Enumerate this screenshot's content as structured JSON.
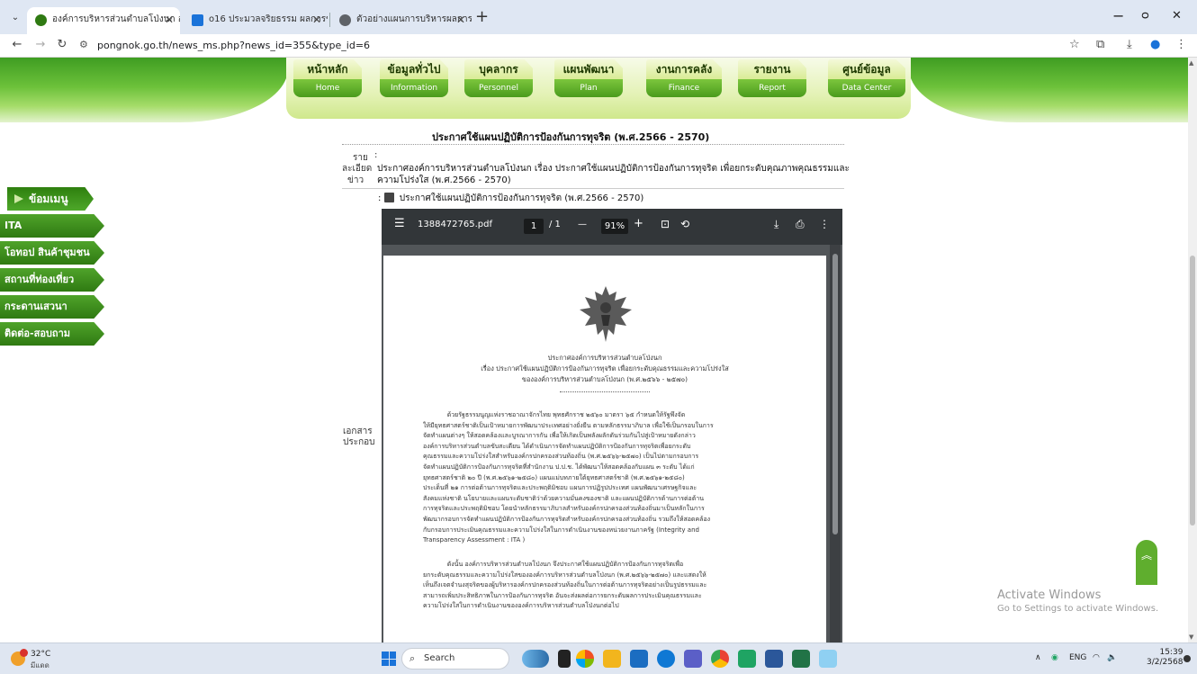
{
  "browser": {
    "tabs": [
      {
        "label": "องค์การบริหารส่วนตำบลโป่งนก อำเภ",
        "favicon_color": "#2f7a12"
      },
      {
        "label": "o16 ประมวลจริยธรรม ผลการขับเคล",
        "favicon_color": "#1a73d9"
      },
      {
        "label": "ตัวอย่างแผนการบริหารผลการพัฒน",
        "favicon_color": "#5f6368"
      }
    ],
    "url": "pongnok.go.th/news_ms.php?news_id=355&type_id=6",
    "window_controls": {
      "minimize": "−",
      "restore": "ᴑ",
      "close": "✕"
    }
  },
  "menu": [
    {
      "th": "หน้าหลัก",
      "en": "Home"
    },
    {
      "th": "ข้อมูลทั่วไป",
      "en": "Information"
    },
    {
      "th": "บุคลากร",
      "en": "Personnel"
    },
    {
      "th": "แผนพัฒนา",
      "en": "Plan"
    },
    {
      "th": "งานการคลัง",
      "en": "Finance"
    },
    {
      "th": "รายงาน",
      "en": "Report"
    },
    {
      "th": "ศูนย์ข้อมูล",
      "en": "Data Center"
    }
  ],
  "sidebar": {
    "header": "ข้อมเมนู",
    "items": [
      "ITA",
      "โอทอป สินค้าชุมชน",
      "สถานที่ท่องเที่ยว",
      "กระดานเสวนา",
      "ติดต่อ-สอบถาม"
    ]
  },
  "news": {
    "title": "ประกาศใช้แผนปฏิบัติการป้องกันการทุจริต (พ.ศ.2566 - 2570)",
    "detail_label_1": "ราย",
    "detail_label_2": "ละเอียด",
    "detail_label_3": "ข่าว",
    "colon": ":",
    "detail_line1": "ประกาศองค์การบริหารส่วนตำบลโป่งนก เรื่อง ประกาศใช้แผนปฏิบัติการป้องกันการทุจริต เพื่อยกระดับคุณภาพคุณธรรมและ",
    "detail_line2": "ความโปร่งใส (พ.ศ.2566 - 2570)",
    "attachment": "ประกาศใช้แผนปฏิบัติการป้องกันการทุจริต (พ.ศ.2566 - 2570)",
    "doc_label_1": "เอกสาร",
    "doc_label_2": "ประกอบ"
  },
  "pdf": {
    "filename": "1388472765.pdf",
    "page_current": "1",
    "page_total": "/ 1",
    "zoom": "91%",
    "zoom_out": "—",
    "zoom_in": "+",
    "header_lines": [
      "ประกาศองค์การบริหารส่วนตำบลโป่งนก",
      "เรื่อง  ประกาศใช้แผนปฏิบัติการป้องกันการทุจริต เพื่อยกระดับคุณธรรมและความโปร่งใส",
      "ขององค์การบริหารส่วนตำบลโป่งนก (พ.ศ.๒๕๖๖ - ๒๕๗๐)"
    ],
    "para1": [
      "            ด้วยรัฐธรรมนูญแห่งราชอาณาจักรไทย พุทธศักราช ๒๕๖๐ มาตรา ๖๕ กำหนดให้รัฐพึงจัด",
      "ให้มียุทธศาสตร์ชาติเป็นเป้าหมายการพัฒนาประเทศอย่างยั่งยืน ตามหลักธรรมาภิบาล เพื่อใช้เป็นกรอบในการ",
      "จัดทำแผนต่างๆ ให้สอดคล้องและบูรณาการกัน เพื่อให้เกิดเป็นพลังผลักดันร่วมกันไปสู่เป้าหมายดังกล่าว",
      "องค์การบริหารส่วนตำบลขับสะเดียน ได้ดำเนินการจัดทำแผนปฏิบัติการป้องกันการทุจริตเพื่อยกระดับ",
      "คุณธรรมและความโปร่งใสสำหรับองค์กรปกครองส่วนท้องถิ่น (พ.ศ.๒๕๖๖-๒๕๗๐) เป็นไปตามกรอบการ",
      "จัดทำแผนปฏิบัติการป้องกันการทุจริตที่สำนักงาน ป.ป.ช. ได้พัฒนาให้สอดคล้องกับแผน ๓ ระดับ ได้แก่",
      "ยุทธศาสตร์ชาติ ๒๐ ปี (พ.ศ.๒๕๖๑-๒๕๘๐) แผนแม่บทภายใต้ยุทธศาสตร์ชาติ (พ.ศ.๒๕๖๑-๒๕๘๐)",
      "ประเด็นที่ ๒๑ การต่อต้านการทุจริตและประพฤติมิชอบ แผนการปฏิรูปประเทศ แผนพัฒนาเศรษฐกิจและ",
      "สังคมแห่งชาติ นโยบายและแผนระดับชาติว่าด้วยความมั่นคงของชาติ และแผนปฏิบัติการด้านการต่อต้าน",
      "การทุจริตและประพฤติมิชอบ โดยนำหลักธรรมาภิบาลสำหรับองค์กรปกครองส่วนท้องถิ่นมาเป็นหลักในการ",
      "พัฒนากรอบการจัดทำแผนปฏิบัติการป้องกันการทุจริตสำหรับองค์กรปกครองส่วนท้องถิ่น รวมถึงให้สอดคล้อง",
      "กับกรอบการประเมินคุณธรรมและความโปร่งใสในการดำเนินงานของหน่วยงานภาครัฐ (Integrity and",
      "Transparency  Assessment : ITA )"
    ],
    "para2": [
      "            ดังนั้น องค์การบริหารส่วนตำบลโป่งนก จึงประกาศใช้แผนปฏิบัติการป้องกันการทุจริตเพื่อ",
      "ยกระดับคุณธรรมและความโปร่งใสขององค์การบริหารส่วนตำบลโป่งนก (พ.ศ.๒๕๖๖-๒๕๗๐) และแสดงให้",
      "เห็นถึงเจตจำนงสุจริตของผู้บริหารองค์กรปกครองส่วนท้องถิ่นในการต่อต้านการทุจริตอย่างเป็นรูปธรรมและ",
      "สามารถเพิ่มประสิทธิภาพในการป้องกันการทุจริต อันจะส่งผลต่อการยกระดับผลการประเมินคุณธรรมและ",
      "ความโปร่งใสในการดำเนินงานขององค์การบริหารส่วนตำบลโป่งนกต่อไป"
    ]
  },
  "watermark": {
    "line1": "Activate Windows",
    "line2": "Go to Settings to activate Windows."
  },
  "taskbar": {
    "temp": "32°C",
    "condition": "มีแดด",
    "search_placeholder": "Search",
    "lang": "ENG",
    "time": "15:39",
    "date": "3/2/2568"
  }
}
